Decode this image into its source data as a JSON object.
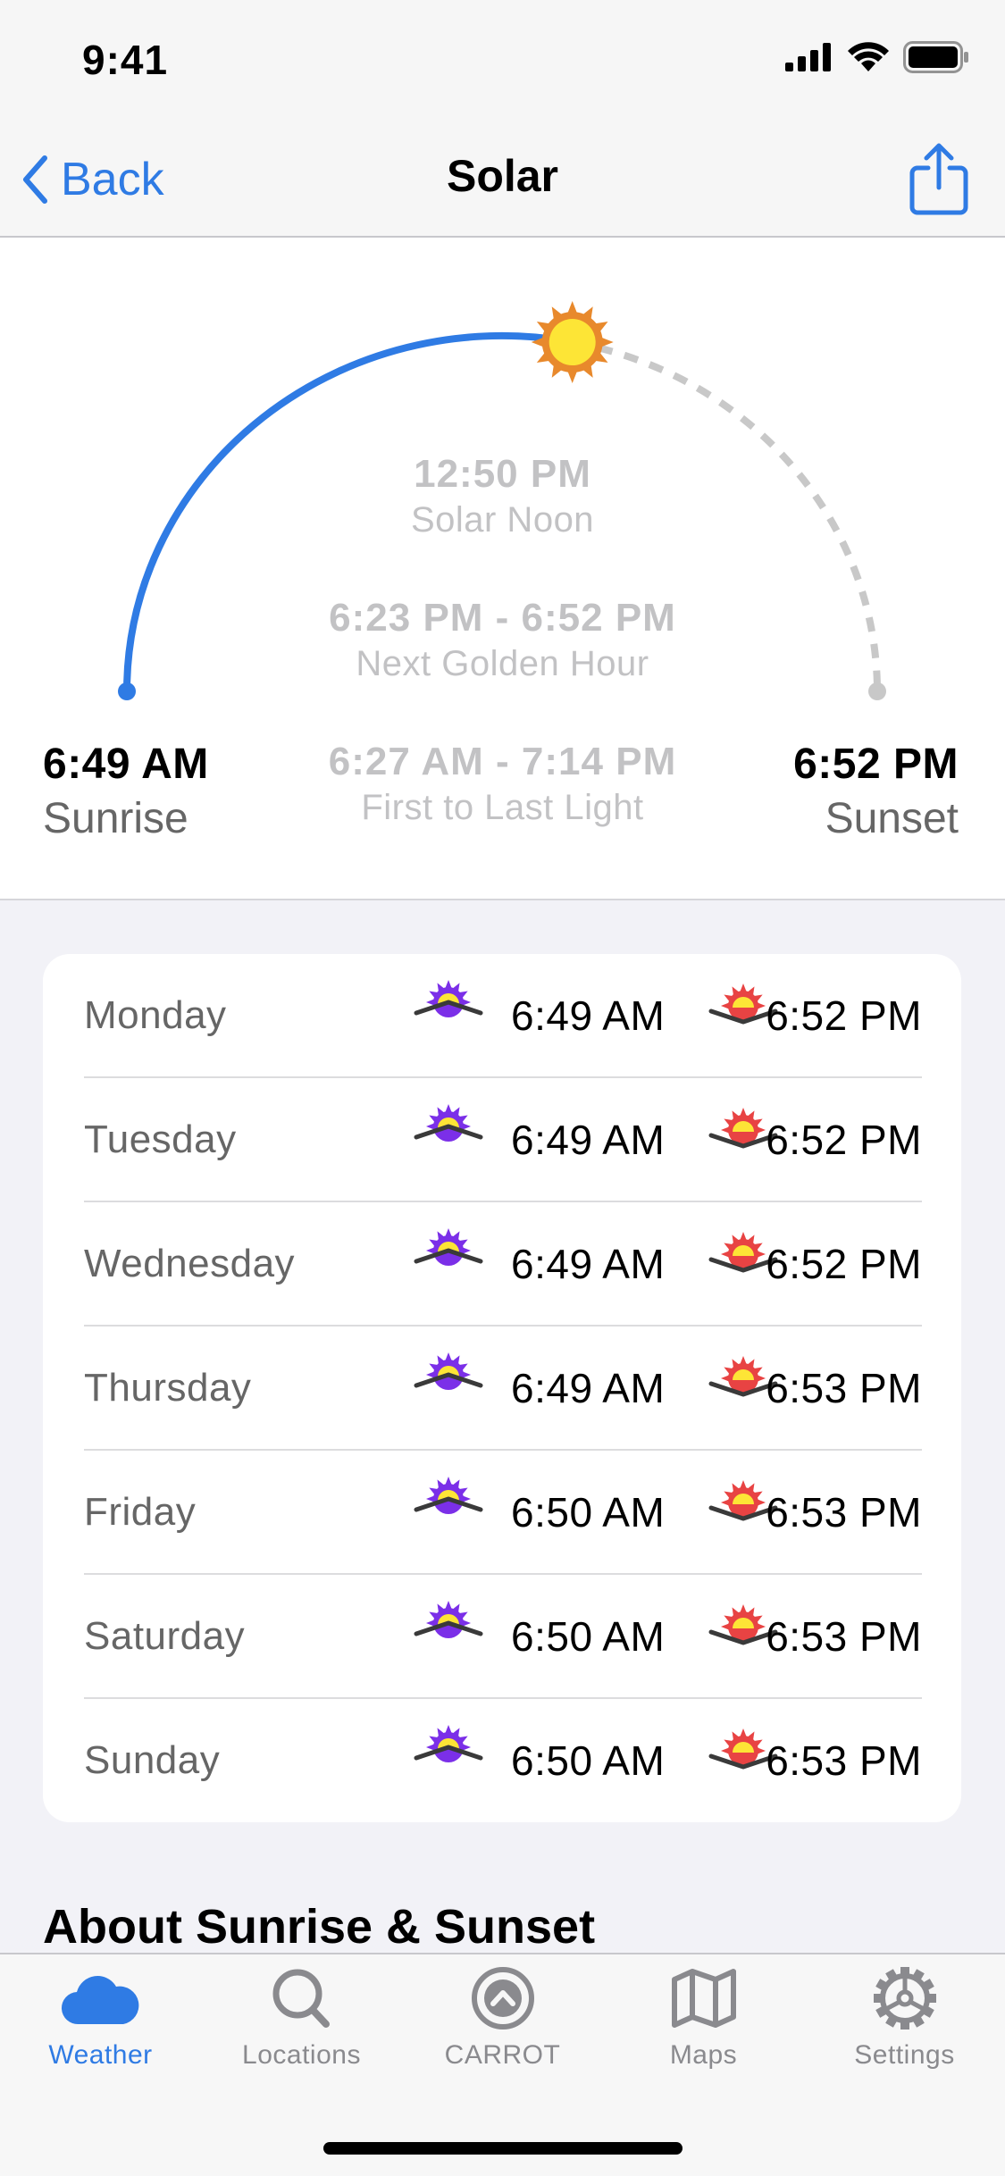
{
  "status_bar": {
    "time": "9:41",
    "icons": [
      "cellular-signal-icon",
      "wifi-icon",
      "battery-icon"
    ]
  },
  "nav": {
    "back_label": "Back",
    "title": "Solar",
    "share_icon": "share-icon"
  },
  "solar": {
    "sunrise": {
      "time": "6:49 AM",
      "label": "Sunrise"
    },
    "sunset": {
      "time": "6:52 PM",
      "label": "Sunset"
    },
    "solar_noon": {
      "time": "12:50 PM",
      "label": "Solar Noon"
    },
    "golden_hour": {
      "time": "6:23 PM - 6:52 PM",
      "label": "Next Golden Hour"
    },
    "light": {
      "time": "6:27 AM - 7:14 PM",
      "label": "First to Last Light"
    },
    "day_progress": 0.56,
    "colors": {
      "elapsed_arc": "#2f7be4",
      "remaining_arc": "#c8c8c8",
      "sun_rays": "#e8892c",
      "sun_core": "#fde536"
    }
  },
  "week": [
    {
      "day": "Monday",
      "sunrise": "6:49 AM",
      "sunset": "6:52 PM"
    },
    {
      "day": "Tuesday",
      "sunrise": "6:49 AM",
      "sunset": "6:52 PM"
    },
    {
      "day": "Wednesday",
      "sunrise": "6:49 AM",
      "sunset": "6:52 PM"
    },
    {
      "day": "Thursday",
      "sunrise": "6:49 AM",
      "sunset": "6:53 PM"
    },
    {
      "day": "Friday",
      "sunrise": "6:50 AM",
      "sunset": "6:53 PM"
    },
    {
      "day": "Saturday",
      "sunrise": "6:50 AM",
      "sunset": "6:53 PM"
    },
    {
      "day": "Sunday",
      "sunrise": "6:50 AM",
      "sunset": "6:53 PM"
    }
  ],
  "week_icons": {
    "sunrise_icon": "sunrise-icon",
    "sunset_icon": "sunset-icon",
    "sunrise_rays_color": "#7b2fe8",
    "sunset_rays_color": "#e84343",
    "sun_color": "#fde536"
  },
  "about": {
    "heading": "About Sunrise & Sunset"
  },
  "tabs": [
    {
      "label": "Weather",
      "icon": "cloud-icon",
      "active": true
    },
    {
      "label": "Locations",
      "icon": "search-icon",
      "active": false
    },
    {
      "label": "CARROT",
      "icon": "carrot-logo-icon",
      "active": false
    },
    {
      "label": "Maps",
      "icon": "map-icon",
      "active": false
    },
    {
      "label": "Settings",
      "icon": "gear-icon",
      "active": false
    }
  ],
  "accent_color": "#2f7be4"
}
